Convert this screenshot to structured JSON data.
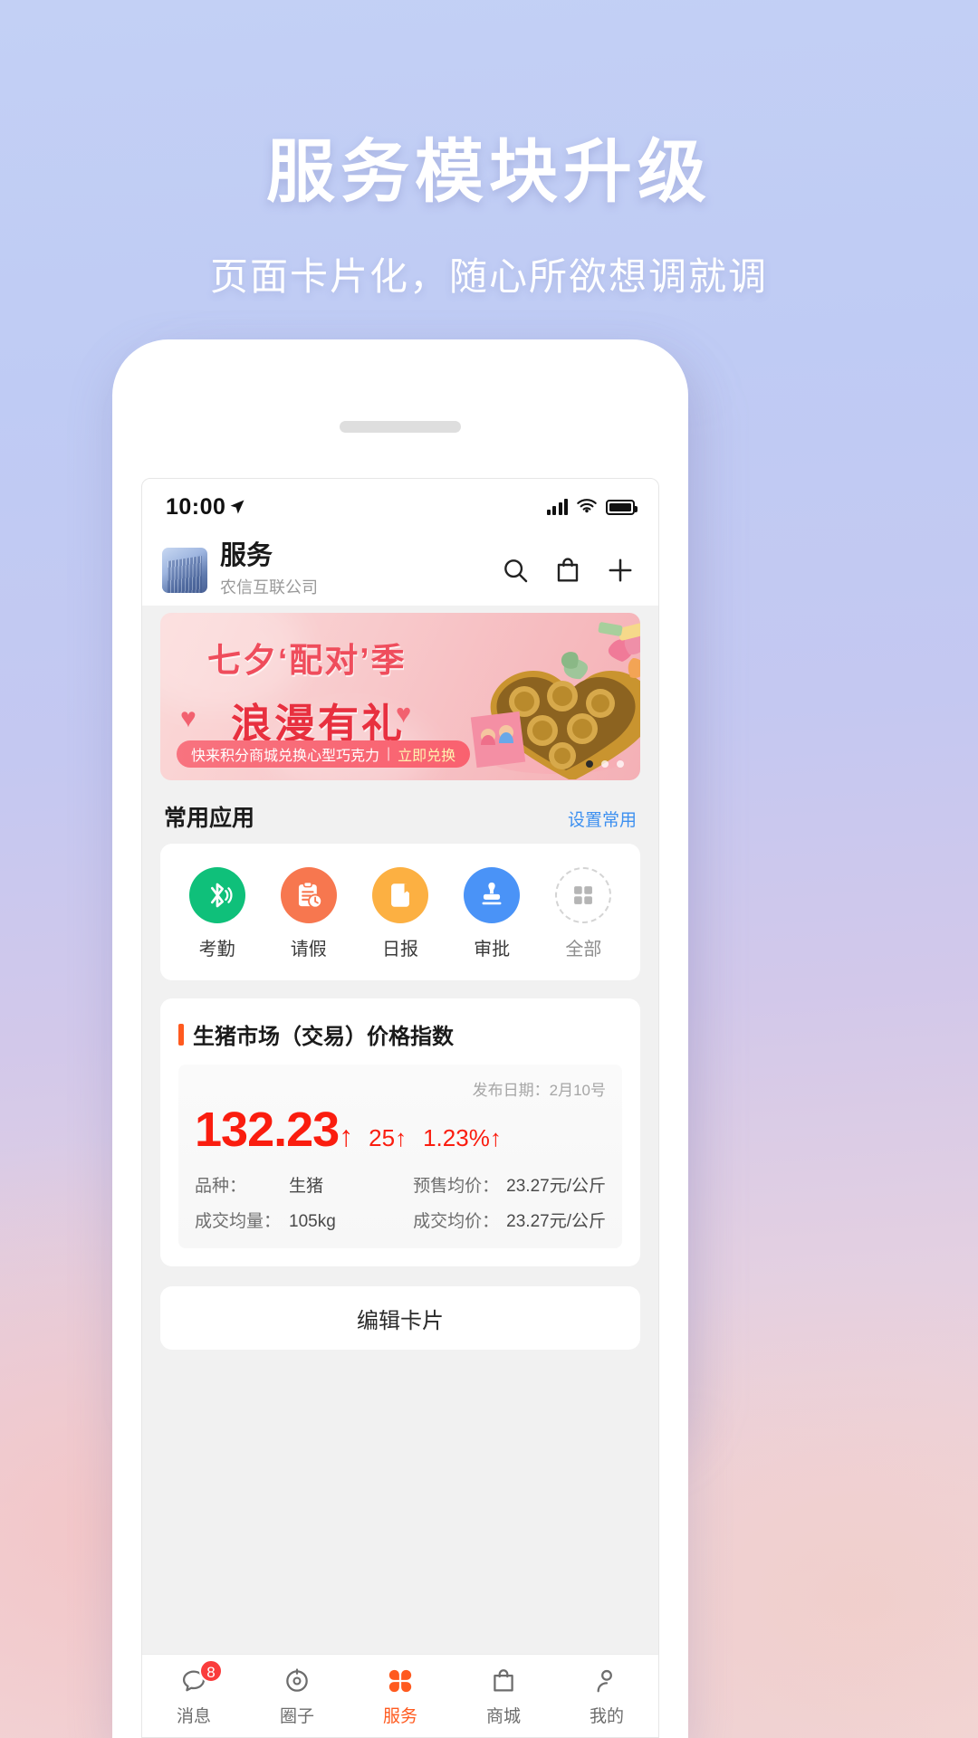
{
  "hero": {
    "title": "服务模块升级",
    "subtitle": "页面卡片化，随心所欲想调就调"
  },
  "phone": {
    "statusbar": {
      "time": "10:00",
      "location_icon": "location-arrow-icon",
      "signal_icon": "cellular-signal-icon",
      "wifi_icon": "wifi-icon",
      "battery_icon": "battery-full-icon"
    },
    "appbar": {
      "title": "服务",
      "company": "农信互联公司",
      "thumb_icon": "building-thumbnail",
      "search_icon": "search-icon",
      "bag_icon": "shopping-bag-icon",
      "plus_icon": "plus-icon"
    },
    "banner": {
      "line1": "七夕‘配对’季",
      "line2": "浪漫有礼",
      "cta_text": "快来积分商城兑换心型巧克力",
      "cta_sep": "|",
      "cta_link": "立即兑换",
      "dot_count": 3,
      "active_dot": 0,
      "gift_icon": "chocolate-gift-box-image"
    },
    "common_apps": {
      "title": "常用应用",
      "settings_link": "设置常用",
      "items": [
        {
          "label": "考勤",
          "icon": "bluetooth-icon",
          "color": "#0fc07a"
        },
        {
          "label": "请假",
          "icon": "clipboard-clock-icon",
          "color": "#f7774f"
        },
        {
          "label": "日报",
          "icon": "book-icon",
          "color": "#fcb042"
        },
        {
          "label": "审批",
          "icon": "stamp-icon",
          "color": "#4a93f7"
        },
        {
          "label": "全部",
          "icon": "grid-all-icon",
          "color": "#d4d4d4"
        }
      ]
    },
    "index_card": {
      "title": "生猪市场（交易）价格指数",
      "accent_color": "#ff5a1f",
      "publish_date_label": "发布日期：",
      "publish_date": "2月10号",
      "value": "132.23",
      "value_arrow": "↑",
      "delta": "25",
      "delta_arrow": "↑",
      "percent": "1.23%",
      "percent_arrow": "↑",
      "value_color": "#fa1d0f",
      "details": [
        {
          "key": "品种：",
          "value": "生猪"
        },
        {
          "key": "预售均价：",
          "value": "23.27元/公斤"
        },
        {
          "key": "成交均量：",
          "value": "105kg"
        },
        {
          "key": "成交均价：",
          "value": "23.27元/公斤"
        }
      ]
    },
    "edit_card_button": "编辑卡片",
    "tabbar": {
      "items": [
        {
          "label": "消息",
          "icon": "chat-bubble-icon",
          "badge": "8",
          "active": false
        },
        {
          "label": "圈子",
          "icon": "circle-refresh-icon",
          "badge": "",
          "active": false
        },
        {
          "label": "服务",
          "icon": "clover-grid-icon",
          "badge": "",
          "active": true
        },
        {
          "label": "商城",
          "icon": "shopping-bag-icon",
          "badge": "",
          "active": false
        },
        {
          "label": "我的",
          "icon": "person-icon",
          "badge": "",
          "active": false
        }
      ],
      "active_color": "#ff5a1f",
      "inactive_color": "#6d6d6d"
    }
  }
}
